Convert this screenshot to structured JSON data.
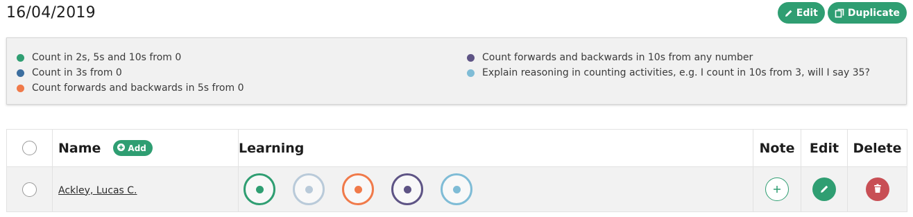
{
  "header": {
    "date": "16/04/2019",
    "edit_label": "Edit",
    "duplicate_label": "Duplicate"
  },
  "objectives": {
    "left": [
      {
        "label": "Count in 2s, 5s and 10s from 0",
        "color": "#2f9e72"
      },
      {
        "label": "Count in 3s from 0",
        "color": "#3c6e9f"
      },
      {
        "label": "Count forwards and backwards in 5s from 0",
        "color": "#f07a4a"
      }
    ],
    "right": [
      {
        "label": "Count forwards and backwards in 10s from any number",
        "color": "#5e5485"
      },
      {
        "label": "Explain reasoning in counting activities, e.g. I count in 10s from 3, will I say 35?",
        "color": "#7fbcd6"
      }
    ]
  },
  "table": {
    "headers": {
      "name": "Name",
      "add": "Add",
      "learning": "Learning",
      "note": "Note",
      "edit": "Edit",
      "delete": "Delete"
    },
    "rows": [
      {
        "name": "Ackley, Lucas C.",
        "rings": [
          {
            "ring": "#2f9e72",
            "dot": "#2f9e72"
          },
          {
            "ring": "#b9cad9",
            "dot": "#b9cad9"
          },
          {
            "ring": "#f07a4a",
            "dot": "#f07a4a"
          },
          {
            "ring": "#5e5485",
            "dot": "#5e5485"
          },
          {
            "ring": "#7fbcd6",
            "dot": "#7fbcd6"
          }
        ]
      }
    ]
  }
}
